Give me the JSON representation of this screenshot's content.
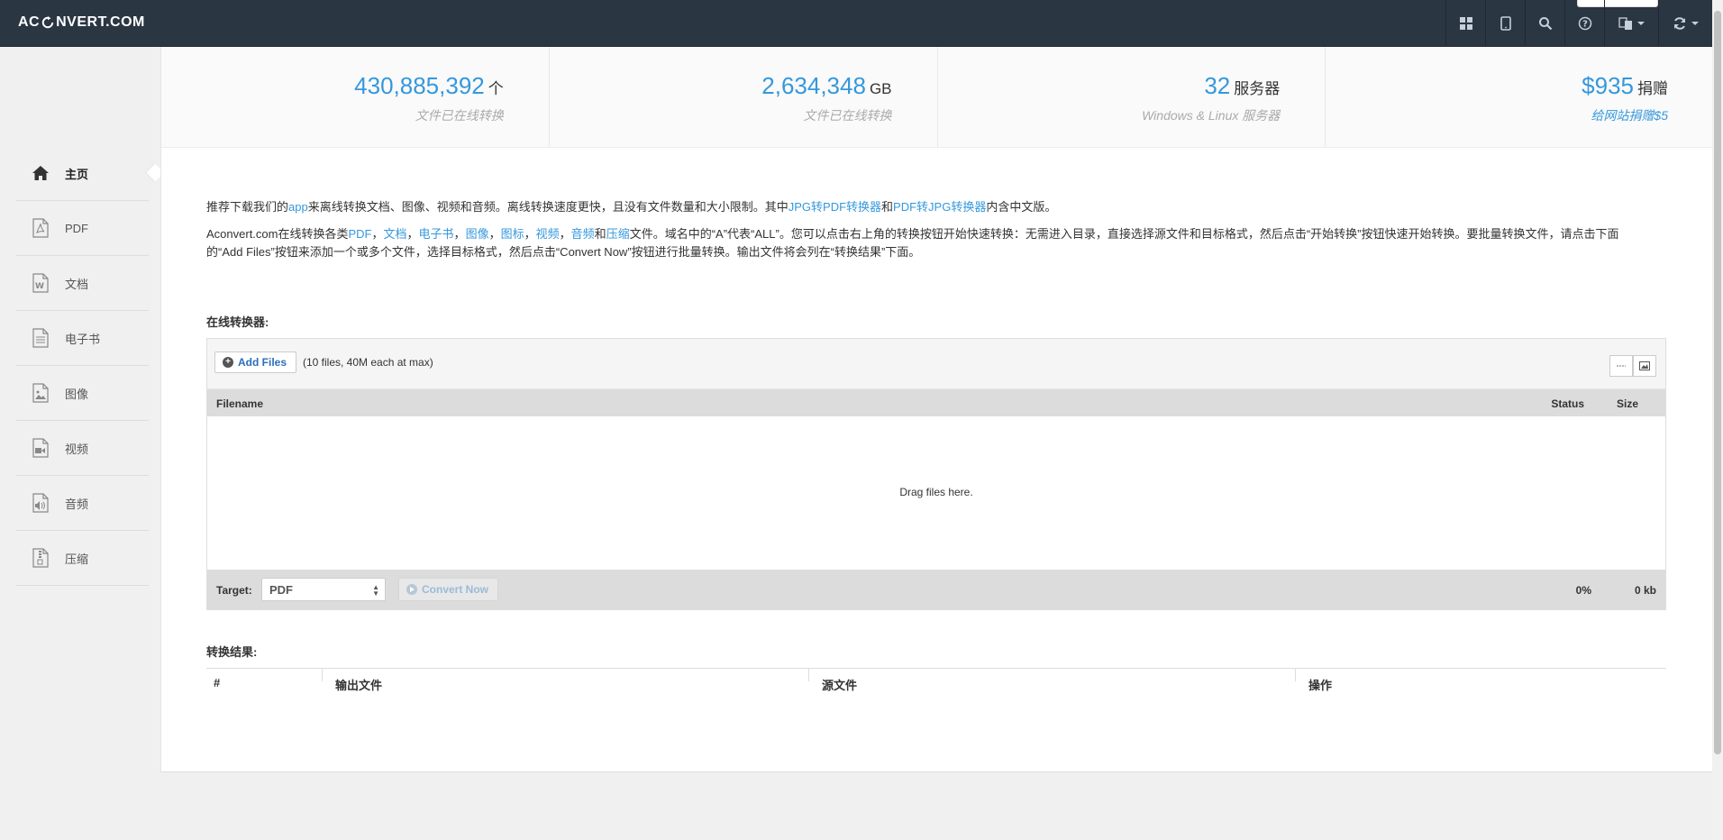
{
  "navbar": {
    "logo_left": "AC",
    "logo_right": "NVERT.COM",
    "icons": [
      "apps-grid-icon",
      "tablet-icon",
      "search-icon",
      "help-icon",
      "language-icon",
      "refresh-icon"
    ]
  },
  "sidebar": {
    "items": [
      {
        "label": "主页",
        "icon": "home-icon",
        "active": true
      },
      {
        "label": "PDF",
        "icon": "pdf-file-icon"
      },
      {
        "label": "文档",
        "icon": "word-file-icon"
      },
      {
        "label": "电子书",
        "icon": "ebook-file-icon"
      },
      {
        "label": "图像",
        "icon": "image-file-icon"
      },
      {
        "label": "视频",
        "icon": "video-file-icon"
      },
      {
        "label": "音频",
        "icon": "audio-file-icon"
      },
      {
        "label": "压缩",
        "icon": "archive-file-icon"
      }
    ]
  },
  "stats": [
    {
      "number": "430,885,392",
      "unit": "个",
      "desc": "文件已在线转换"
    },
    {
      "number": "2,634,348",
      "unit": "GB",
      "desc": "文件已在线转换"
    },
    {
      "number": "32",
      "unit": "服务器",
      "desc": "Windows & Linux 服务器"
    },
    {
      "number": "$935",
      "unit": "捐赠",
      "desc": "给网站捐赠$5"
    }
  ],
  "intro": {
    "p1": {
      "t1": "推荐下载我们的",
      "link_app": "app",
      "t2": "来离线转换文档、图像、视频和音频。离线转换速度更快，且没有文件数量和大小限制。其中",
      "link_jpg2pdf": "JPG转PDF转换器",
      "t3": "和",
      "link_pdf2jpg": "PDF转JPG转换器",
      "t4": "内含中文版。"
    },
    "p2": {
      "t1": "Aconvert.com在线转换各类",
      "links": [
        "PDF",
        "文档",
        "电子书",
        "图像",
        "图标",
        "视频",
        "音频"
      ],
      "sep": "，",
      "and": "和",
      "link_last": "压缩",
      "t2": "文件。域名中的“A”代表“ALL”。您可以点击右上角的转换按钮开始快速转换：无需进入目录，直接选择源文件和目标格式，然后点击“开始转换”按钮快速开始转换。要批量转换文件，请点击下面的“Add Files”按钮来添加一个或多个文件，选择目标格式，然后点击“Convert Now”按钮进行批量转换。输出文件将会列在“转换结果”下面。"
    }
  },
  "converter": {
    "title": "在线转换器:",
    "add_files": "Add Files",
    "limit": "(10 files, 40M each at max)",
    "col_filename": "Filename",
    "col_status": "Status",
    "col_size": "Size",
    "drop_text": "Drag files here.",
    "target_label": "Target:",
    "target_value": "PDF",
    "convert_now": "Convert Now",
    "percent": "0%",
    "total_size": "0 kb"
  },
  "results": {
    "title": "转换结果:",
    "columns": [
      "#",
      "输出文件",
      "源文件",
      "操作"
    ]
  }
}
